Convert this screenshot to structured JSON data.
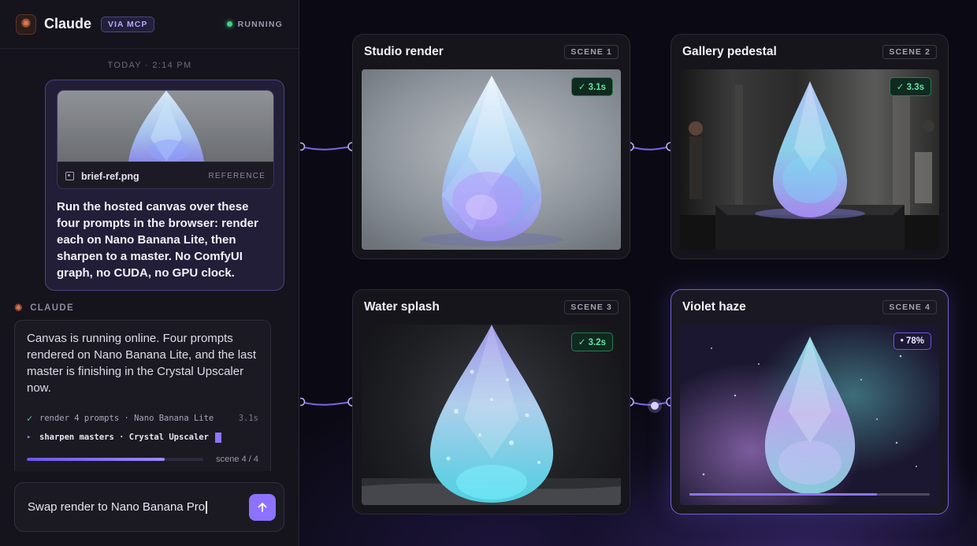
{
  "sidebar": {
    "app_name": "Claude",
    "badge": "VIA MCP",
    "status": "RUNNING",
    "timestamp": "TODAY · 2:14 PM",
    "user_message": {
      "attachment_name": "brief-ref.png",
      "attachment_tag": "REFERENCE",
      "text": "Run the hosted canvas over these four prompts in the browser: render each on Nano Banana Lite, then sharpen to a master. No ComfyUI graph, no CUDA, no GPU clock."
    },
    "assistant": {
      "label": "CLAUDE",
      "text": "Canvas is running online. Four prompts rendered on Nano Banana Lite, and the last master is finishing in the Crystal Upscaler now.",
      "log": [
        {
          "mark": "✓",
          "text": "render 4 prompts · Nano Banana Lite",
          "time": "3.1s"
        },
        {
          "mark": "▸",
          "text": "sharpen masters · Crystal Upscaler",
          "time": ""
        }
      ],
      "progress_value": 0.78,
      "progress_label": "scene 4 / 4"
    },
    "composer": {
      "value": "Swap render to Nano Banana Pro"
    }
  },
  "canvas": {
    "cards": [
      {
        "title": "Studio render",
        "scene": "SCENE 1",
        "badge": "✓ 3.1s",
        "status": "done"
      },
      {
        "title": "Gallery pedestal",
        "scene": "SCENE 2",
        "badge": "✓ 3.3s",
        "status": "done"
      },
      {
        "title": "Water splash",
        "scene": "SCENE 3",
        "badge": "✓ 3.2s",
        "status": "done"
      },
      {
        "title": "Violet haze",
        "scene": "SCENE 4",
        "badge": "• 78%",
        "status": "running",
        "progress_value": 0.78
      }
    ]
  },
  "colors": {
    "accent": "#8d72ff",
    "success": "#46d38f",
    "brand": "#e0764e"
  },
  "icons": {
    "logo": "claude-star-icon",
    "send": "arrow-up-icon",
    "file": "image-file-icon"
  }
}
